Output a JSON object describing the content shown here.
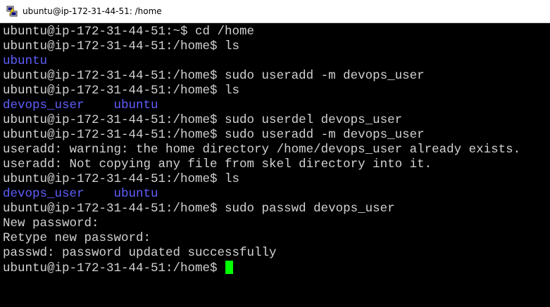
{
  "window": {
    "title": "ubuntu@ip-172-31-44-51: /home"
  },
  "colors": {
    "background": "#000000",
    "text": "#d2d2d2",
    "directory": "#5f5fff",
    "cursor": "#00ff00"
  },
  "icons": {
    "app": "putty-icon"
  },
  "terminal": {
    "lines": [
      "ubuntu@ip-172-31-44-51:~$ cd /home",
      "ubuntu@ip-172-31-44-51:/home$ ls",
      [
        "ubuntu"
      ],
      "ubuntu@ip-172-31-44-51:/home$ sudo useradd -m devops_user",
      "ubuntu@ip-172-31-44-51:/home$ ls",
      [
        "devops_user",
        "ubuntu"
      ],
      "ubuntu@ip-172-31-44-51:/home$ sudo userdel devops_user",
      "ubuntu@ip-172-31-44-51:/home$ sudo useradd -m devops_user",
      "useradd: warning: the home directory /home/devops_user already exists.",
      "useradd: Not copying any file from skel directory into it.",
      "ubuntu@ip-172-31-44-51:/home$ ls",
      [
        "devops_user",
        "ubuntu"
      ],
      "ubuntu@ip-172-31-44-51:/home$ sudo passwd devops_user",
      "New password:",
      "Retype new password:",
      "passwd: password updated successfully"
    ],
    "prompt": "ubuntu@ip-172-31-44-51:/home$"
  }
}
